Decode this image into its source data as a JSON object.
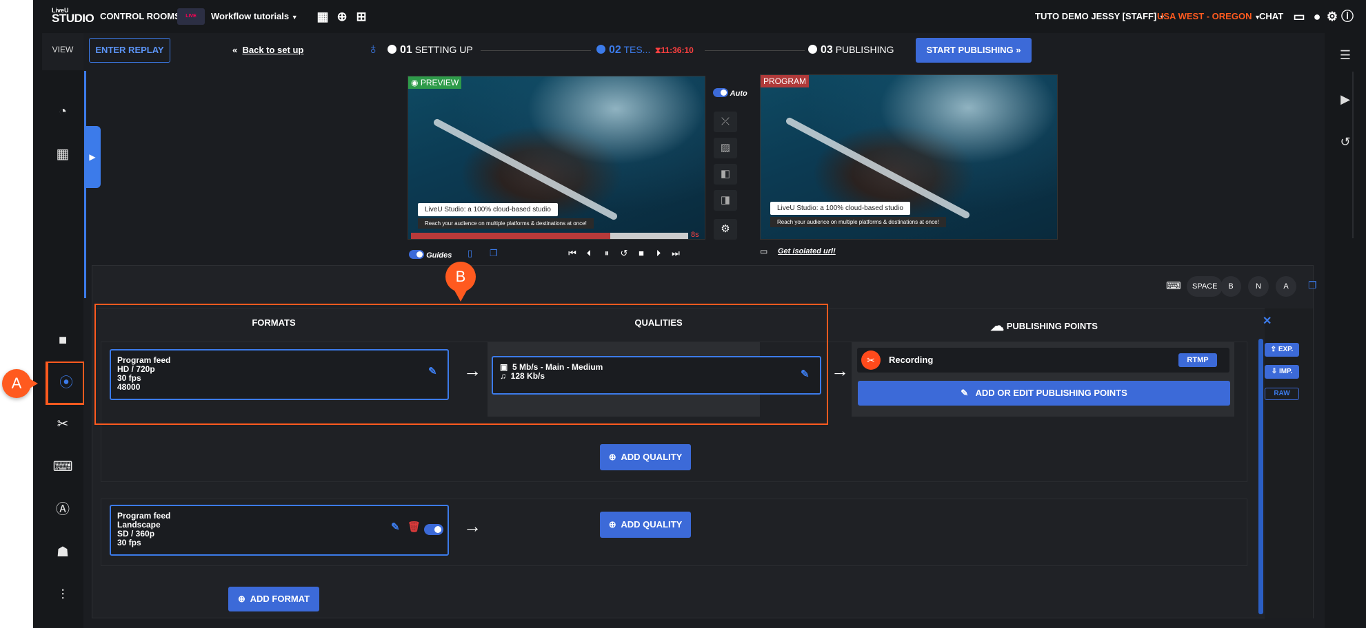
{
  "topbar": {
    "logo_line1": "LiveU",
    "logo_line2": "STUDIO",
    "control_rooms": "CONTROL ROOMS",
    "thumb_text": "LIVE",
    "workflow": "Workflow tutorials",
    "user": "TUTO DEMO JESSY [STAFF]",
    "region": "USA WEST - OREGON",
    "chat": "CHAT",
    "region_color": "#ff5a1f"
  },
  "sidebar": {
    "view": "VIEW"
  },
  "steps": {
    "enter_replay": "ENTER REPLAY",
    "back": "Back to set up",
    "s1_num": "01",
    "s1_label": "SETTING UP",
    "s2_num": "02",
    "s2_label": "TES...",
    "timer": "11:36:10",
    "s3_num": "03",
    "s3_label": "PUBLISHING",
    "start": "START PUBLISHING"
  },
  "preview": {
    "label": "PREVIEW",
    "caption1": "LiveU Studio: a 100% cloud-based studio",
    "caption2": "Reach your audience on multiple platforms & destinations at once!",
    "seconds": "8s",
    "progress_fraction": 0.72,
    "guides": "Guides"
  },
  "program": {
    "label": "PROGRAM",
    "caption1": "LiveU Studio: a 100% cloud-based studio",
    "caption2": "Reach your audience on multiple platforms & destinations at once!",
    "auto": "Auto",
    "isolated": "Get isolated url!"
  },
  "panel": {
    "keys": {
      "space": "SPACE",
      "b": "B",
      "n": "N",
      "a": "A"
    },
    "formats_head": "FORMATS",
    "qualities_head": "QUALITIES",
    "publishing_head": "PUBLISHING POINTS",
    "format1": {
      "name": "Program feed",
      "res": "HD / 720p",
      "fps": "30 fps",
      "audio": "48000"
    },
    "quality1": {
      "video": "5 Mb/s  -  Main  -  Medium",
      "audio": "128 Kb/s"
    },
    "pp1": {
      "name": "Recording",
      "proto": "RTMP"
    },
    "add_edit_pp": "ADD OR EDIT PUBLISHING POINTS",
    "add_quality": "ADD QUALITY",
    "format2": {
      "name": "Program feed",
      "orient": "Landscape",
      "res": "SD / 360p",
      "fps": "30 fps"
    },
    "add_format": "ADD FORMAT",
    "exp": "EXP.",
    "imp": "IMP.",
    "raw": "RAW"
  },
  "annotations": {
    "a": "A",
    "b": "B",
    "color": "#ff5a1f"
  }
}
